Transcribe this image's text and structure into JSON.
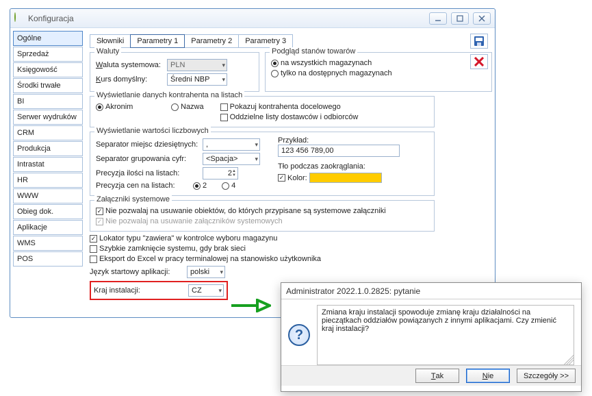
{
  "window": {
    "title": "Konfiguracja",
    "sidebar": {
      "items": [
        {
          "label": "Ogólne",
          "selected": true
        },
        {
          "label": "Sprzedaż"
        },
        {
          "label": "Księgowość"
        },
        {
          "label": "Środki trwałe"
        },
        {
          "label": "BI"
        },
        {
          "label": "Serwer wydruków"
        },
        {
          "label": "CRM"
        },
        {
          "label": "Produkcja"
        },
        {
          "label": "Intrastat"
        },
        {
          "label": "HR"
        },
        {
          "label": "WWW"
        },
        {
          "label": "Obieg dok."
        },
        {
          "label": "Aplikacje"
        },
        {
          "label": "WMS"
        },
        {
          "label": "POS"
        }
      ]
    },
    "tabs": {
      "items": [
        {
          "label": "Słowniki"
        },
        {
          "label": "Parametry 1",
          "active": true
        },
        {
          "label": "Parametry 2"
        },
        {
          "label": "Parametry 3"
        }
      ]
    },
    "groups": {
      "waluty": {
        "title": "Waluty",
        "waluta_label": "Waluta systemowa:",
        "waluta_value": "PLN",
        "kurs_label": "Kurs domyślny:",
        "kurs_value": "Średni NBP"
      },
      "stany": {
        "title": "Podgląd stanów towarów",
        "opt_all": "na wszystkich magazynach",
        "opt_avail": "tylko na dostępnych magazynach"
      },
      "kontrahent": {
        "title": "Wyświetlanie danych kontrahenta na listach",
        "opt_akronim": "Akronim",
        "opt_nazwa": "Nazwa",
        "chk_docelowy": "Pokazuj kontrahenta docelowego",
        "chk_listy": "Oddzielne listy dostawców i odbiorców"
      },
      "liczby": {
        "title": "Wyświetlanie wartości liczbowych",
        "sep_dec_label": "Separator miejsc dziesiętnych:",
        "sep_dec_value": ",",
        "sep_grp_label": "Separator grupowania cyfr:",
        "sep_grp_value": "<Spacja>",
        "prec_ilosc_label": "Precyzja ilości na listach:",
        "prec_ilosc_value": "2",
        "prec_cen_label": "Precyzja cen na listach:",
        "prec_cen_opt2": "2",
        "prec_cen_opt4": "4",
        "example_label": "Przykład:",
        "example_value": "123 456 789,00",
        "tlo_label": "Tło podczas zaokrąglania:",
        "kolor_label": "Kolor:",
        "kolor_value": "#ffcc00"
      },
      "zalaczniki": {
        "title": "Załączniki systemowe",
        "chk1": "Nie pozwalaj na usuwanie obiektów, do których przypisane są systemowe załączniki",
        "chk2": "Nie pozwalaj na usuwanie załączników systemowych"
      },
      "loose": {
        "chk_lokator": "Lokator typu \"zawiera\" w kontrolce wyboru magazynu",
        "chk_szybkie": "Szybkie zamknięcie systemu, gdy brak sieci",
        "chk_excel": "Eksport do Excel w pracy terminalowej na stanowisko użytkownika",
        "jezyk_label": "Język startowy aplikacji:",
        "jezyk_value": "polski",
        "kraj_label": "Kraj instalacji:",
        "kraj_value": "CZ"
      }
    }
  },
  "dialog": {
    "title": "Administrator 2022.1.0.2825: pytanie",
    "message": "Zmiana kraju instalacji spowoduje zmianę kraju działalności na pieczątkach oddziałów powiązanych z innymi aplikacjami. Czy zmienić kraj instalacji?",
    "btn_tak": "Tak",
    "btn_nie": "Nie",
    "btn_szcz": "Szczegóły >>"
  }
}
